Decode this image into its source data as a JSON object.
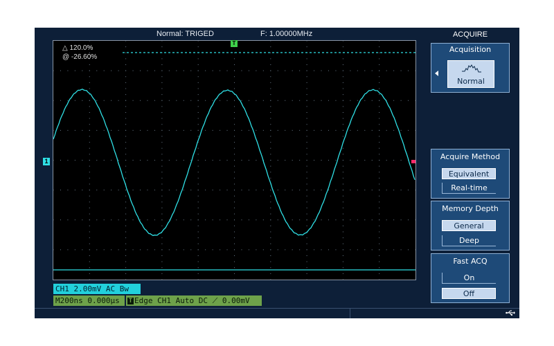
{
  "status": {
    "mode": "Normal: TRIGED",
    "frequency": "F: 1.00000MHz"
  },
  "markers": {
    "trigger": "T",
    "channel": "1"
  },
  "cursor": {
    "delta": "△ 120.0%",
    "at": "@ -26.60%"
  },
  "info": {
    "ch1": "CH1  2.00mV  AC  Bw",
    "timebase": "M200ns 0.000µs",
    "trigger_icon": "T",
    "trigger": "Edge CH1  Auto DC ⟋  0.00mV"
  },
  "menu": {
    "title": "ACQUIRE",
    "acquisition": {
      "title": "Acquisition",
      "value": "Normal",
      "icon": "normal-waveform-icon"
    },
    "acquire_method": {
      "title": "Acquire Method",
      "options": [
        "Equivalent",
        "Real-time"
      ],
      "selected": "Equivalent"
    },
    "memory_depth": {
      "title": "Memory Depth",
      "options": [
        "General",
        "Deep"
      ],
      "selected": "General"
    },
    "fast_acq": {
      "title": "Fast ACQ",
      "options": [
        "On",
        "Off"
      ],
      "selected": "Off"
    }
  },
  "colors": {
    "trace": "#2fe0e6",
    "trigger": "#3fd04a",
    "trigger_level": "#ff2a6a",
    "panel": "#1e4a78"
  }
}
